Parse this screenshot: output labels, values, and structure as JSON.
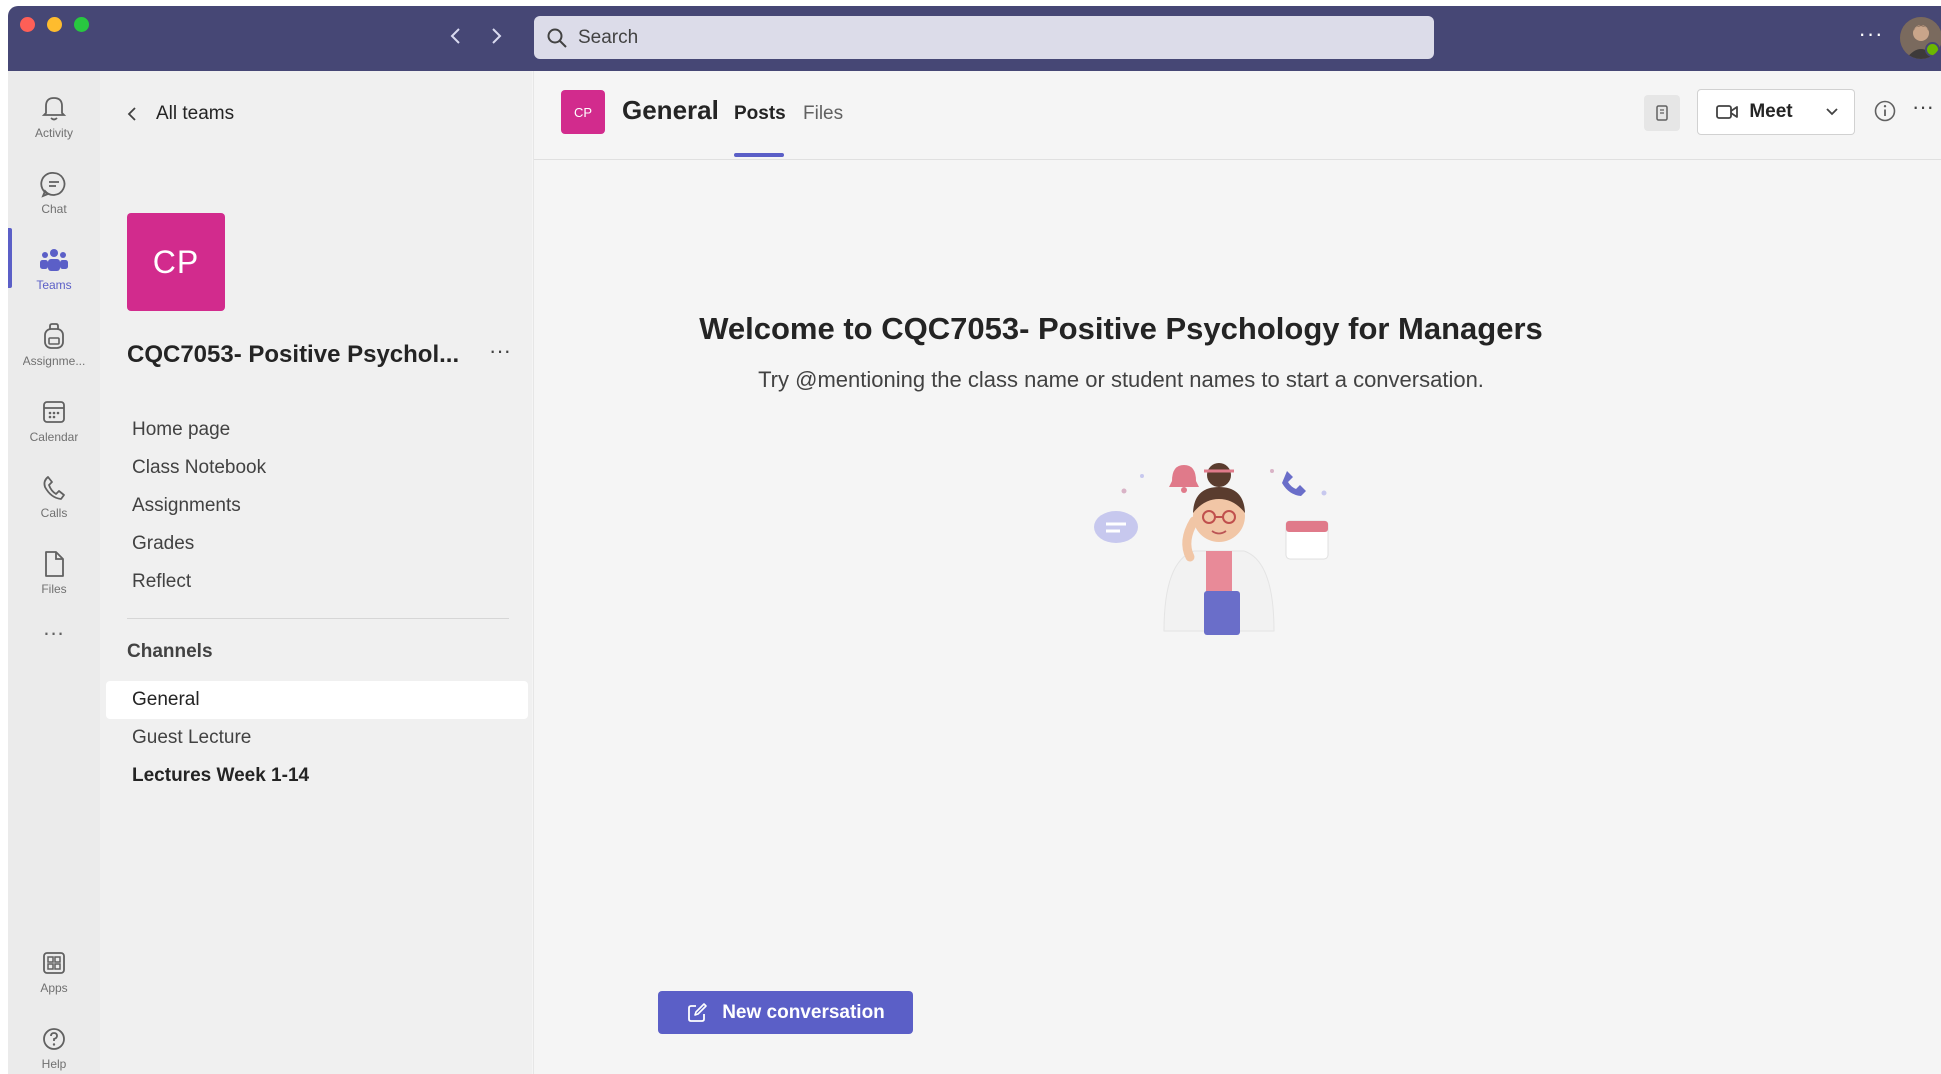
{
  "search": {
    "placeholder": "Search"
  },
  "rail": {
    "items": [
      {
        "label": "Activity",
        "icon": "bell-icon"
      },
      {
        "label": "Chat",
        "icon": "chat-icon"
      },
      {
        "label": "Teams",
        "icon": "teams-icon",
        "active": true
      },
      {
        "label": "Assignme...",
        "icon": "backpack-icon"
      },
      {
        "label": "Calendar",
        "icon": "calendar-icon"
      },
      {
        "label": "Calls",
        "icon": "phone-icon"
      },
      {
        "label": "Files",
        "icon": "file-icon"
      },
      {
        "label": "...",
        "icon": "more-icon"
      },
      {
        "label": "Apps",
        "icon": "apps-icon"
      },
      {
        "label": "Help",
        "icon": "help-icon"
      }
    ]
  },
  "teampane": {
    "back_label": "All teams",
    "team_initials": "CP",
    "team_name": "CQC7053- Positive Psychol...",
    "tabs": [
      "Home page",
      "Class Notebook",
      "Assignments",
      "Grades",
      "Reflect"
    ],
    "channels_heading": "Channels",
    "channels": [
      {
        "name": "General",
        "selected": true
      },
      {
        "name": "Guest Lecture"
      },
      {
        "name": "Lectures Week 1-14",
        "bold": true
      }
    ]
  },
  "main": {
    "channel_initials": "CP",
    "channel_title": "General",
    "tabs": [
      {
        "label": "Posts",
        "active": true
      },
      {
        "label": "Files"
      }
    ],
    "meet_label": "Meet",
    "welcome_title": "Welcome to CQC7053- Positive Psychology for Managers",
    "welcome_subtitle": "Try @mentioning the class name or student names to start a conversation.",
    "new_conversation_label": "New conversation"
  },
  "colors": {
    "titlebar": "#464775",
    "accent": "#5b5fc7",
    "team_tile": "#d22b8d"
  }
}
